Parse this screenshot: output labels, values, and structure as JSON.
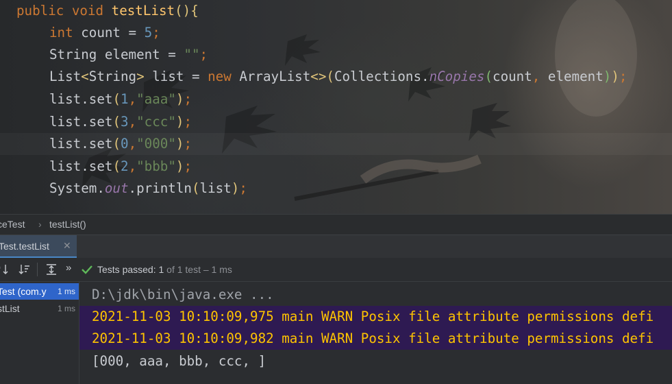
{
  "editor": {
    "tokens": {
      "public": "public",
      "void": "void",
      "method_name": "testList",
      "int": "int",
      "count": "count",
      "count_value": "5",
      "string_type": "String",
      "element": "element",
      "empty_string": "\"\"",
      "list_type": "List",
      "list_var": "list",
      "new": "new",
      "arraylist": "ArrayList",
      "collections": "Collections",
      "ncopies": "nCopies",
      "set": "set",
      "system": "System",
      "out": "out",
      "println": "println",
      "idx1": "1",
      "idx3": "3",
      "idx0": "0",
      "idx2": "2",
      "s_aaa": "\"aaa\"",
      "s_ccc": "\"ccc\"",
      "s_000": "\"000\"",
      "s_bbb": "\"bbb\""
    }
  },
  "breadcrumb": {
    "class_name": "ceTest",
    "method_name": "testList()"
  },
  "run_tab": {
    "label": "Test.testList",
    "close_glyph": "✕"
  },
  "toolbar": {
    "status_label": "Tests passed: 1",
    "status_detail": " of 1 test – 1 ms",
    "more_glyph": "»"
  },
  "test_tree": {
    "rows": [
      {
        "label": "Test (com.y",
        "time": "1 ms",
        "selected": true
      },
      {
        "label": "stList",
        "time": "1 ms",
        "selected": false
      }
    ]
  },
  "console": {
    "command": "D:\\jdk\\bin\\java.exe ...",
    "warn_lines": [
      "2021-11-03 10:10:09,975 main WARN Posix file attribute permissions defi",
      "2021-11-03 10:10:09,982 main WARN Posix file attribute permissions defi"
    ],
    "output": "[000, aaa, bbb, ccc, ]"
  },
  "colors": {
    "keyword": "#cc7832",
    "method": "#ffc66d",
    "number": "#6897bb",
    "string": "#6a8759",
    "static_field": "#9876aa",
    "warn_text": "#ffc400",
    "warn_bg": "#2e1a52",
    "selection": "#2f65ca",
    "passed_check": "#5fb85a"
  }
}
